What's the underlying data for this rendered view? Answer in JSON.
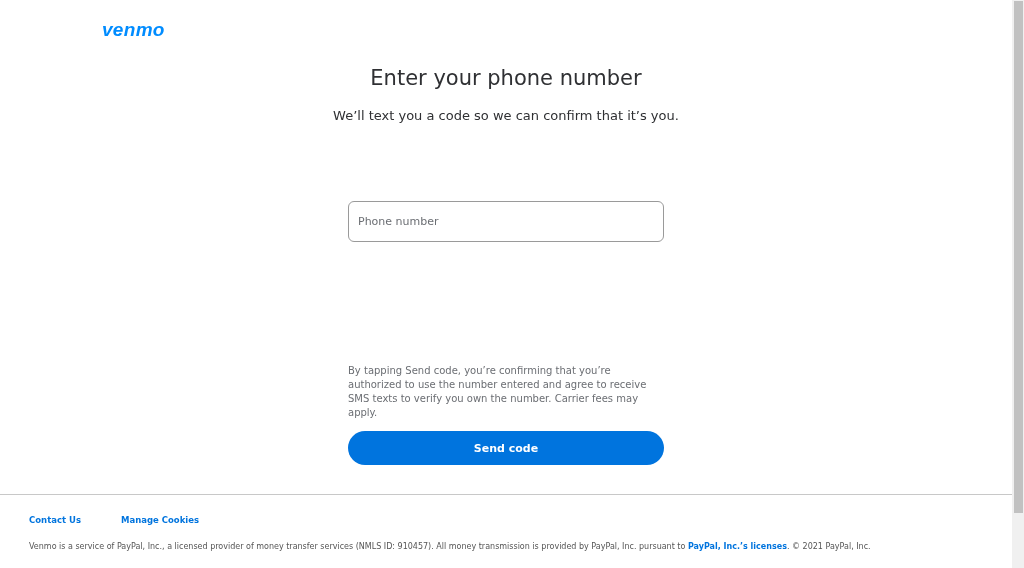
{
  "logo": "venmo",
  "heading": "Enter your phone number",
  "subheading": "We’ll text you a code so we can confirm that it’s you.",
  "phone_field": {
    "placeholder": "Phone number"
  },
  "consent": "By tapping Send code, you’re confirming that you’re authorized to use the number entered and agree to receive SMS texts to verify you own the number. Carrier fees may apply.",
  "send_button": "Send code",
  "footer": {
    "links": [
      "Contact Us",
      "Manage Cookies"
    ],
    "legal_before": "Venmo is a service of PayPal, Inc., a licensed provider of money transfer services (NMLS ID: 910457). All money transmission is provided by PayPal, Inc. pursuant to",
    "legal_link": "PayPal, Inc.’s licenses",
    "legal_after": ". © 2021 PayPal, Inc."
  }
}
